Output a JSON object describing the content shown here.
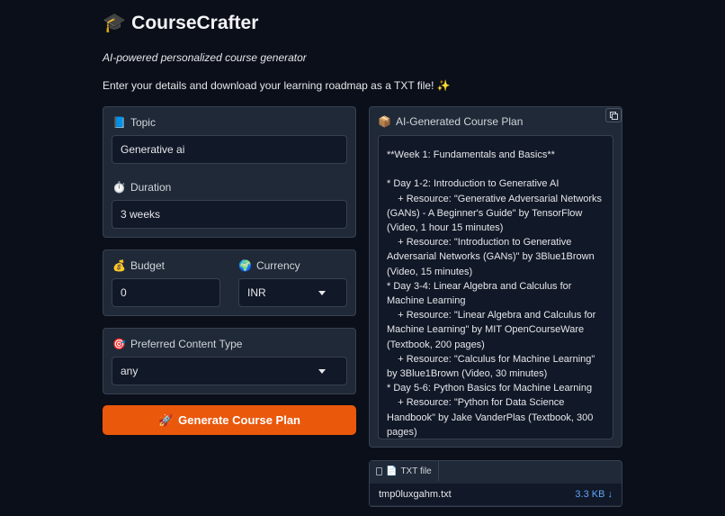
{
  "app": {
    "icon": "🎓",
    "title": "CourseCrafter",
    "subtitle": "AI-powered personalized course generator",
    "intro": "Enter your details and download your learning roadmap as a TXT file! ✨"
  },
  "form": {
    "topic": {
      "icon": "📘",
      "label": "Topic",
      "value": "Generative ai"
    },
    "duration": {
      "icon": "⏱️",
      "label": "Duration",
      "value": "3 weeks"
    },
    "budget": {
      "icon": "💰",
      "label": "Budget",
      "value": "0"
    },
    "currency": {
      "icon": "🌍",
      "label": "Currency",
      "value": "INR"
    },
    "content_type": {
      "icon": "🎯",
      "label": "Preferred Content Type",
      "value": "any"
    },
    "generate_button": {
      "icon": "🚀",
      "label": "Generate Course Plan"
    }
  },
  "output": {
    "icon": "📦",
    "label": "AI-Generated Course Plan",
    "text": "**Week 1: Fundamentals and Basics**\n\n* Day 1-2: Introduction to Generative AI\n    + Resource: \"Generative Adversarial Networks (GANs) - A Beginner's Guide\" by TensorFlow (Video, 1 hour 15 minutes)\n    + Resource: \"Introduction to Generative Adversarial Networks (GANs)\" by 3Blue1Brown (Video, 15 minutes)\n* Day 3-4: Linear Algebra and Calculus for Machine Learning\n    + Resource: \"Linear Algebra and Calculus for Machine Learning\" by MIT OpenCourseWare (Textbook, 200 pages)\n    + Resource: \"Calculus for Machine Learning\" by 3Blue1Brown (Video, 30 minutes)\n* Day 5-6: Python Basics for Machine Learning\n    + Resource: \"Python for Data Science Handbook\" by Jake VanderPlas (Textbook, 300 pages)\n    + Resource: \"Python Tutorial for Machine"
  },
  "file": {
    "icon": "📄",
    "tab_label": "TXT file",
    "name": "tmp0luxgahm.txt",
    "size": "3.3 KB ↓"
  }
}
